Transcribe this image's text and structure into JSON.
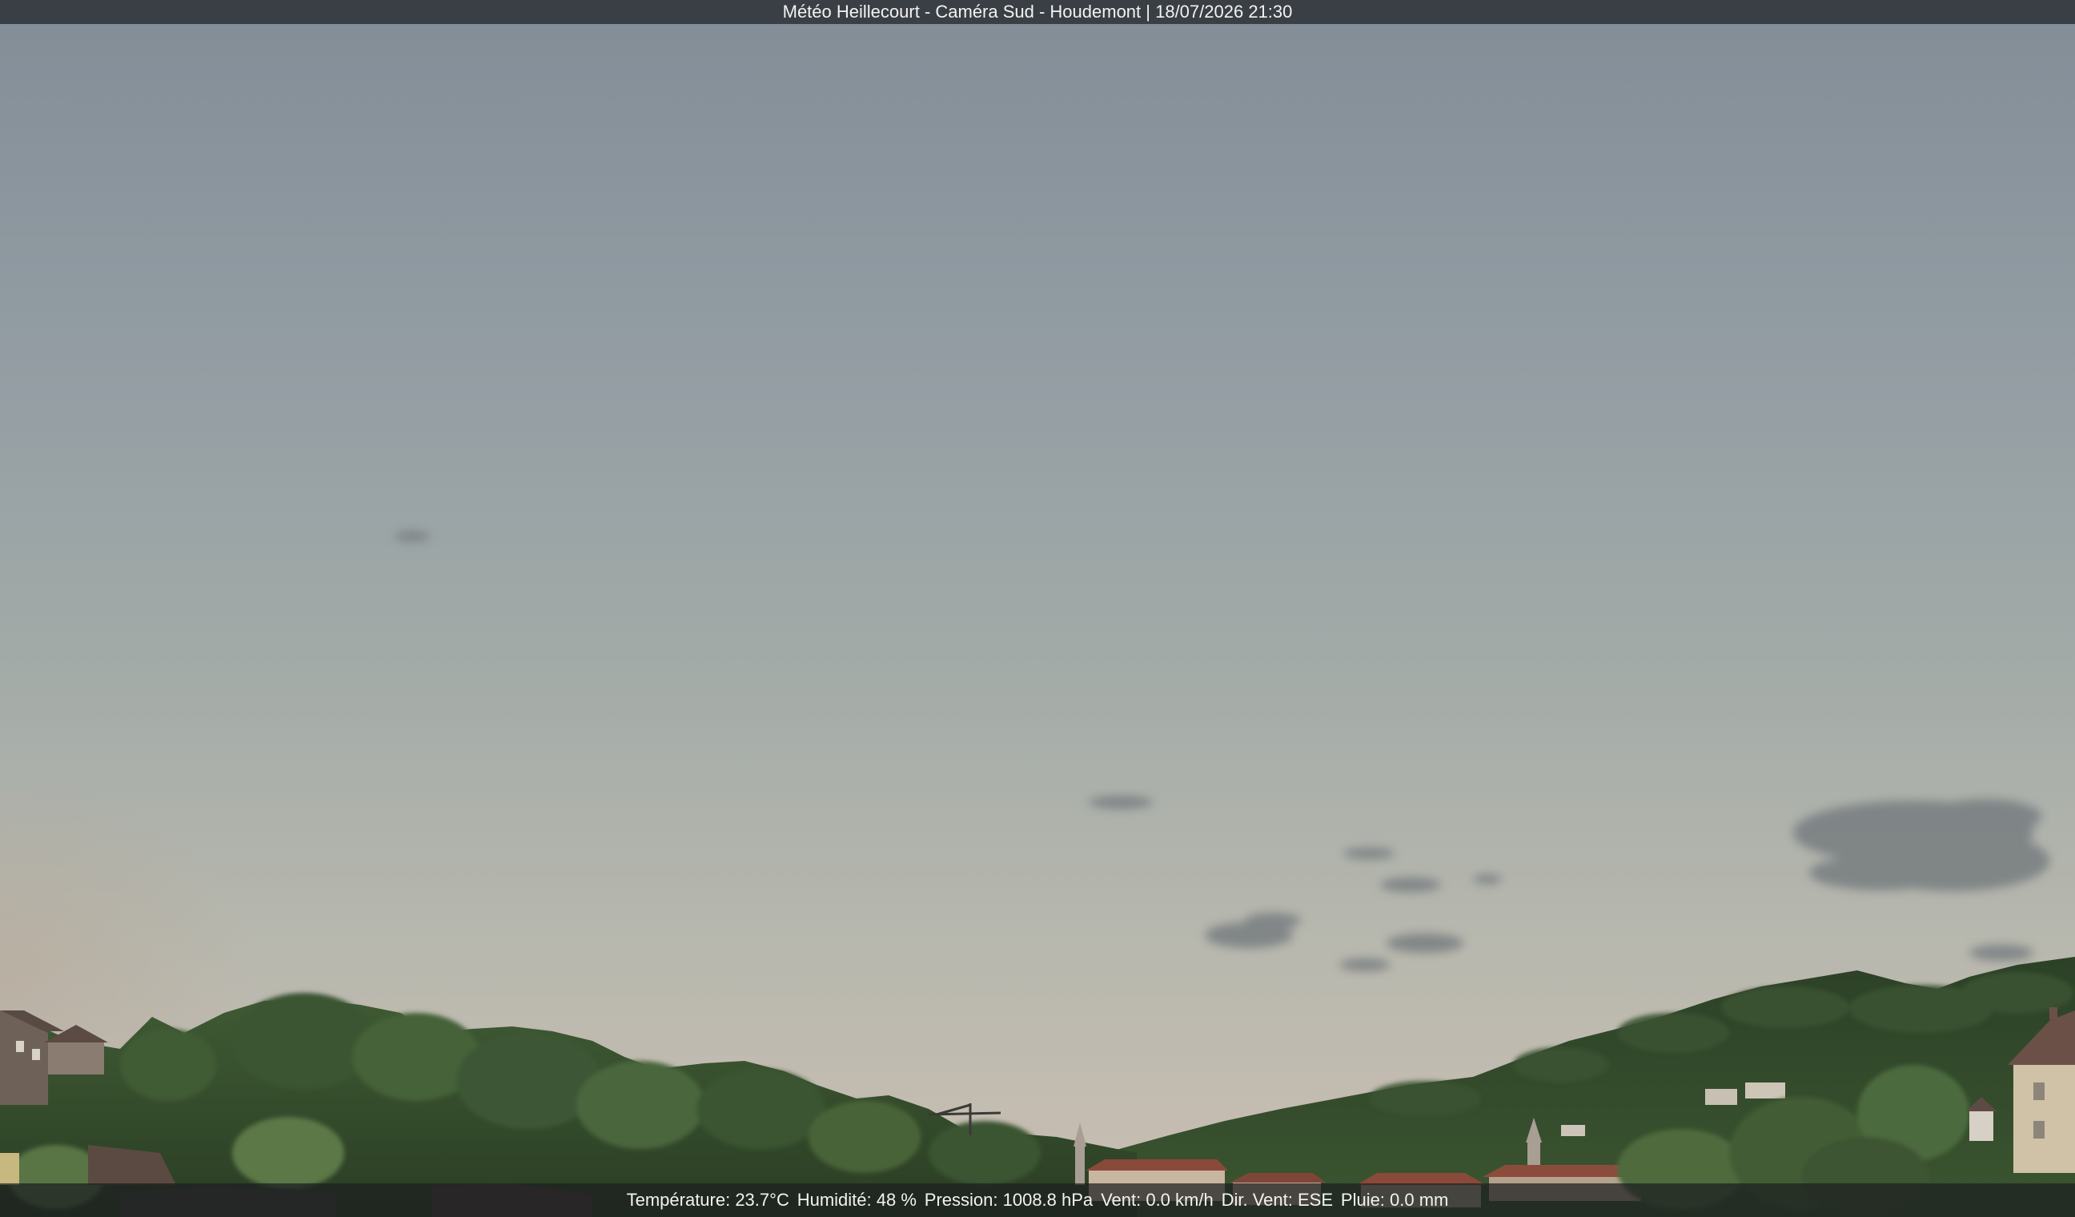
{
  "camera": {
    "title": "Météo Heillecourt - Caméra Sud - Houdemont | 18/07/2026 21:30"
  },
  "weather": {
    "temperature": "Température: 23.7°C",
    "humidity": "Humidité: 48 %",
    "pressure": "Pression: 1008.8 hPa",
    "wind_speed": "Vent: 0.0 km/h",
    "wind_direction": "Dir. Vent: ESE",
    "rain": "Pluie: 0.0 mm"
  },
  "colors": {
    "sky_top": "#848f98",
    "sky_mid": "#9aa4a6",
    "sky_horizon": "#c2bbb0",
    "trees_dark": "#2f4a2a",
    "trees_light": "#54703f",
    "roof_red": "#8a4a3a"
  }
}
